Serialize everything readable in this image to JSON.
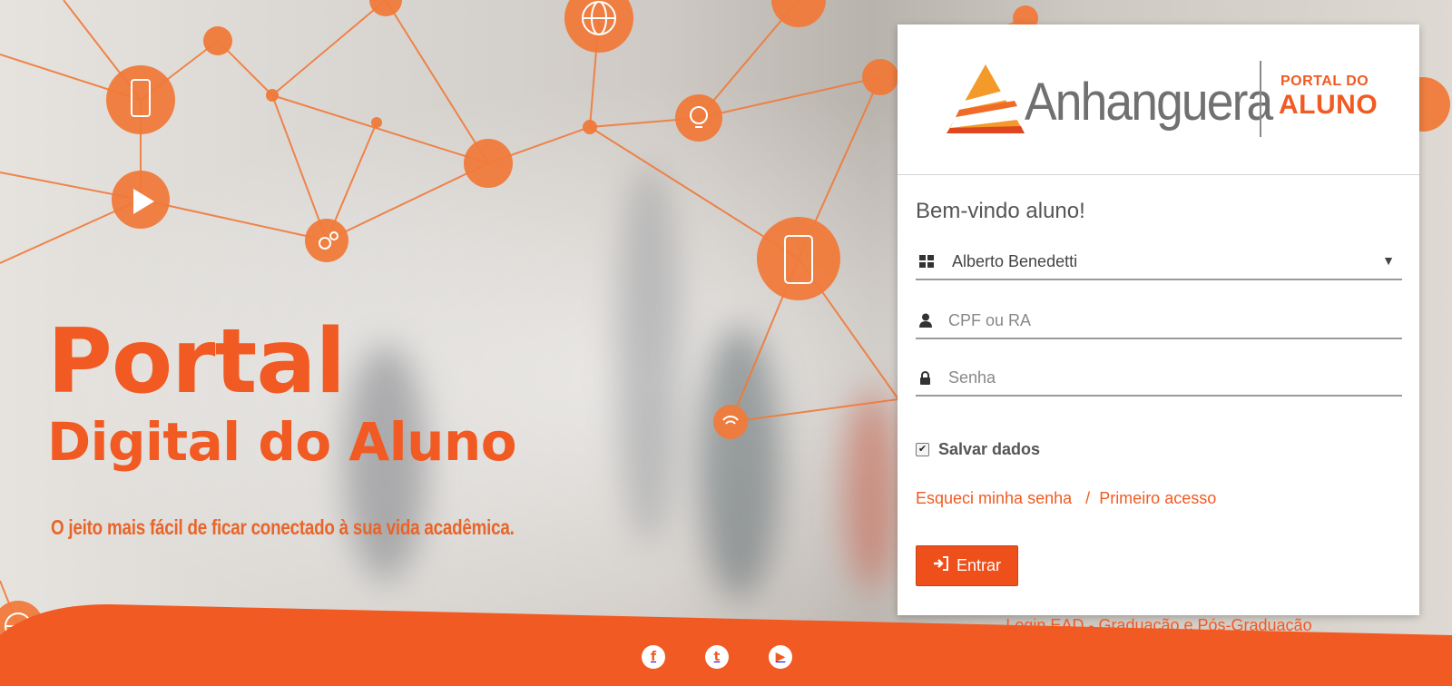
{
  "hero": {
    "title_line1": "Portal",
    "title_line2": "Digital do Aluno",
    "subtitle": "O jeito mais fácil de ficar conectado à sua vida acadêmica."
  },
  "brand": {
    "name": "Anhanguera",
    "portal_label": "PORTAL DO",
    "aluno_label": "ALUNO"
  },
  "login": {
    "welcome": "Bem-vindo aluno!",
    "profile_select": {
      "value": "Alberto Benedetti",
      "icon": "grid-icon"
    },
    "cpf_field": {
      "placeholder": "CPF ou RA",
      "value": "",
      "icon": "user-icon"
    },
    "password_field": {
      "placeholder": "Senha",
      "value": "",
      "icon": "lock-icon"
    },
    "save_data": {
      "label": "Salvar dados",
      "checked": true
    },
    "forgot_link": "Esqueci minha senha",
    "separator": "/",
    "first_access_link": "Primeiro acesso",
    "submit_label": "Entrar",
    "ead_link": "Login EAD - Graduação e Pós-Graduação"
  },
  "social": [
    {
      "name": "facebook-icon",
      "glyph": "f"
    },
    {
      "name": "twitter-icon",
      "glyph": "t"
    },
    {
      "name": "youtube-icon",
      "glyph": "▶"
    }
  ],
  "colors": {
    "accent": "#f15a22",
    "button": "#ee4f1b",
    "text_gray": "#555555"
  }
}
